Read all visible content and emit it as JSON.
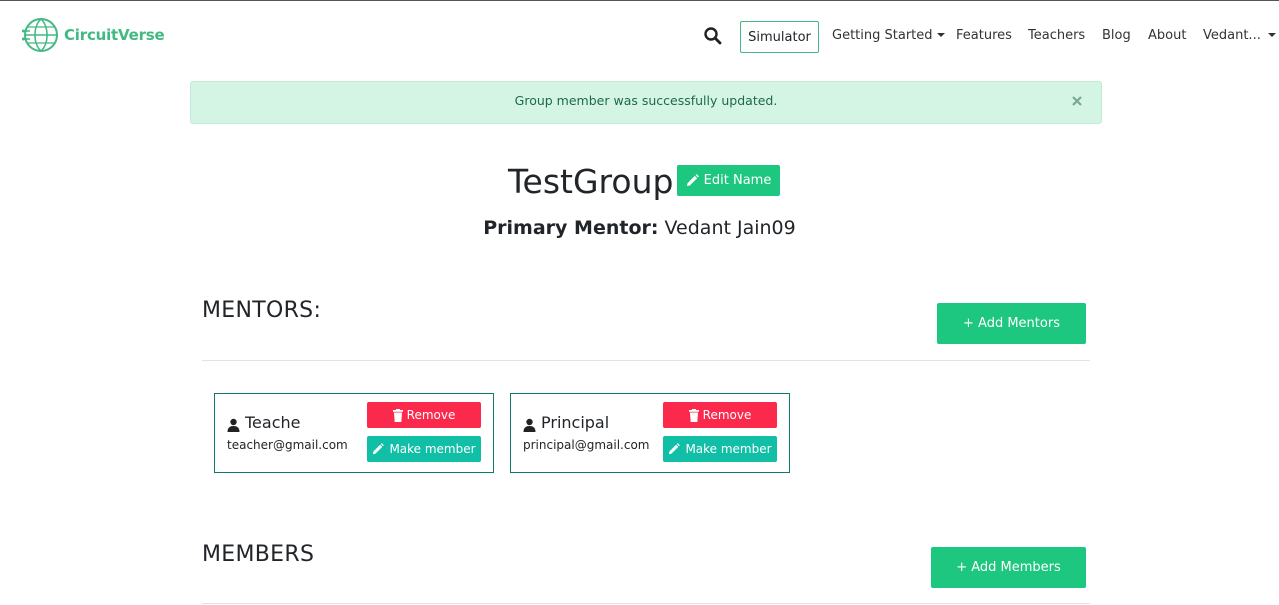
{
  "nav": {
    "brand": "CircuitVerse",
    "simulator": "Simulator",
    "getting_started": "Getting Started",
    "features": "Features",
    "teachers": "Teachers",
    "blog": "Blog",
    "about": "About",
    "user": "Vedant..."
  },
  "alert": {
    "message": "Group member was successfully updated."
  },
  "group": {
    "name": "TestGroup",
    "edit_label": "Edit Name",
    "primary_mentor_label": "Primary Mentor:",
    "primary_mentor_name": "Vedant Jain09"
  },
  "mentors": {
    "title": "MENTORS:",
    "add_label": "+ Add Mentors",
    "cards": [
      {
        "name": "Teache",
        "email": "teacher@gmail.com",
        "remove_label": "Remove",
        "make_member_label": "Make member"
      },
      {
        "name": "Principal",
        "email": "principal@gmail.com",
        "remove_label": "Remove",
        "make_member_label": "Make member"
      }
    ]
  },
  "members": {
    "title": "MEMBERS",
    "add_label": "+ Add Members"
  },
  "colors": {
    "brand": "#42b983",
    "primary_button": "#1ec77f",
    "danger_button": "#fb2a4c",
    "teal_button": "#11bfa7",
    "alert_bg": "#d4f4e4"
  }
}
